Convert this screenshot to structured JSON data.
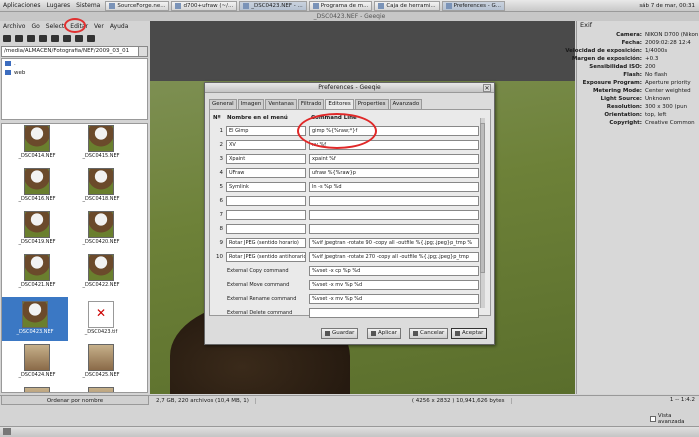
{
  "panel": {
    "menus": [
      "Aplicaciones",
      "Lugares",
      "Sistema"
    ],
    "tasks": [
      "SourceForge.ne...",
      "d700+ufraw (~/...",
      "_DSC0423.NEF - ...",
      "Programa de m...",
      "Caja de herrami...",
      "Preferences - G..."
    ],
    "clock": "sáb 7 de mar, 00:31"
  },
  "window": {
    "title": "_DSC0423.NEF - Geeqie"
  },
  "menubar": [
    "Archivo",
    "Go",
    "Select",
    "Editar",
    "Ver",
    "Ayuda"
  ],
  "browser": {
    "path": "/media/ALMACEN/Fotografia/NEF/2009_03_01",
    "dirs": [
      ".",
      "web"
    ],
    "thumbnails": [
      "_DSC0414.NEF",
      "_DSC0415.NEF",
      "_DSC0416.NEF",
      "_DSC0418.NEF",
      "_DSC0419.NEF",
      "_DSC0420.NEF",
      "_DSC0421.NEF",
      "_DSC0422.NEF",
      "_DSC0423.NEF",
      "_DSC0423.tif",
      "_DSC0424.NEF",
      "_DSC0425.NEF",
      "_DSC0426.NEF",
      "_DSC0427.NEF",
      "_DSC0428.NEF",
      "_DSC0429.NEF"
    ],
    "sort_label": "Ordenar por nombre"
  },
  "status": {
    "summary": "2,7 GB, 220 archivos (10,4 MB, 1)",
    "dimensions": "( 4256 x 2832 ) 10,941,626 bytes",
    "zoom": "1 -- 1:4.2"
  },
  "exif": {
    "title": "Exif",
    "rows": [
      {
        "k": "Camera:",
        "v": "NIKON D700 (Nikon"
      },
      {
        "k": "Fecha:",
        "v": "2009:02:28 12:4"
      },
      {
        "k": "Velocidad de exposición:",
        "v": "1/4000s"
      },
      {
        "k": "Margen de exposición:",
        "v": "+0.3"
      },
      {
        "k": "Sensibilidad ISO:",
        "v": "200"
      },
      {
        "k": "Flash:",
        "v": "No flash"
      },
      {
        "k": "Exposure Program:",
        "v": "Aperture priority"
      },
      {
        "k": "Metering Mode:",
        "v": "Center weighted"
      },
      {
        "k": "Light Source:",
        "v": "Unknown"
      },
      {
        "k": "Resolution:",
        "v": "300 x 300 (pun"
      },
      {
        "k": "Orientation:",
        "v": "top, left"
      },
      {
        "k": "Copyright:",
        "v": "Creative Common"
      }
    ],
    "vista_label": "Vista avanzada"
  },
  "dialog": {
    "title": "Preferences - Geeqie",
    "tabs": [
      "General",
      "Imagen",
      "Ventanas",
      "Filtrado",
      "Editores",
      "Properties",
      "Avanzado"
    ],
    "active_tab": "Editores",
    "headers": {
      "num": "Nº",
      "name": "Nombre en el menú",
      "cmd": "Command Line"
    },
    "editors": [
      {
        "num": "1",
        "name": "El Gimp",
        "cmd": "gimp %{%raw;*}f"
      },
      {
        "num": "2",
        "name": "XV",
        "cmd": "xv %f"
      },
      {
        "num": "3",
        "name": "Xpaint",
        "cmd": "xpaint %f"
      },
      {
        "num": "4",
        "name": "UFraw",
        "cmd": "ufraw %{%raw}p"
      },
      {
        "num": "5",
        "name": "Symlink",
        "cmd": "ln -s %p %d"
      },
      {
        "num": "6",
        "name": "",
        "cmd": ""
      },
      {
        "num": "7",
        "name": "",
        "cmd": ""
      },
      {
        "num": "8",
        "name": "",
        "cmd": ""
      },
      {
        "num": "9",
        "name": "Rotar JPEG (sentido horario)",
        "cmd": "%vif jpegtran -rotate 90 -copy all -outfile %{.jpg;.jpeg}p_tmp %"
      },
      {
        "num": "10",
        "name": "Rotar JPEG (sentido antihorario)",
        "cmd": "%vif jpegtran -rotate 270 -copy all -outfile %{.jpg;.jpeg}p_tmp"
      }
    ],
    "external": [
      {
        "name": "External Copy command",
        "cmd": "%vset -x cp %p %d"
      },
      {
        "name": "External Move command",
        "cmd": "%vset -x mv %p %d"
      },
      {
        "name": "External Rename command",
        "cmd": "%vset -x mv %p %d"
      },
      {
        "name": "External Delete command",
        "cmd": ""
      }
    ],
    "buttons": {
      "save": "Guardar",
      "apply": "Aplicar",
      "cancel": "Cancelar",
      "accept": "Aceptar"
    }
  },
  "colors": {
    "accent": "#3b78c4",
    "annotation": "#e03030"
  }
}
